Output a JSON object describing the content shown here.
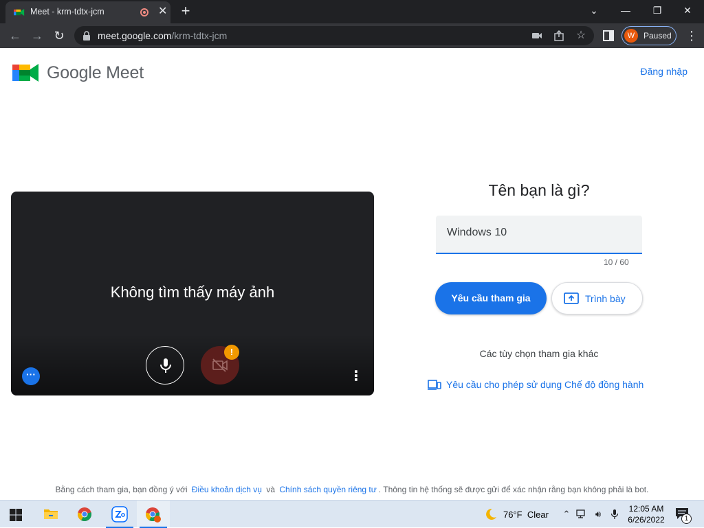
{
  "browser": {
    "tab_title": "Meet - krm-tdtx-jcm",
    "new_tab_label": "+",
    "url_host": "meet.google.com",
    "url_path": "/krm-tdtx-jcm",
    "profile_initial": "W",
    "profile_status": "Paused"
  },
  "header": {
    "logo_text": "Google Meet",
    "signin_label": "Đăng nhập"
  },
  "preview": {
    "message": "Không tìm thấy máy ảnh",
    "warning_badge": "!"
  },
  "join": {
    "question": "Tên bạn là gì?",
    "name_value": "Windows 10",
    "char_count": "10 / 60",
    "ask_join_label": "Yêu cầu tham gia",
    "present_label": "Trình bày",
    "other_options": "Các tùy chọn tham gia khác",
    "companion_label": "Yêu cầu cho phép sử dụng Chế độ đồng hành"
  },
  "footer": {
    "prefix": "Bằng cách tham gia, bạn đồng ý với",
    "terms_label": "Điều khoản dịch vụ",
    "and": "và",
    "privacy_label": "Chính sách quyền riêng tư",
    "suffix": ". Thông tin hệ thống sẽ được gửi để xác nhận rằng bạn không phải là bot."
  },
  "taskbar": {
    "temperature": "76°F",
    "weather": "Clear",
    "time": "12:05 AM",
    "date": "6/26/2022",
    "notification_count": "1"
  },
  "colors": {
    "accent": "#1a73e8",
    "preview_bg": "#202124",
    "camera_off": "#5c1e1c",
    "warning": "#f29900"
  }
}
